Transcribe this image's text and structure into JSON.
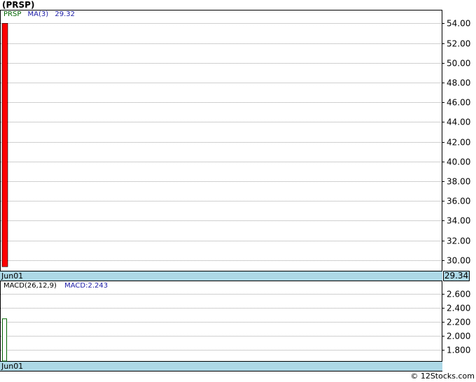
{
  "header": {
    "title": "(PRSP)"
  },
  "price_panel": {
    "symbol_label": "PRSP",
    "ma_label": "MA(3)",
    "ma_value": "29.32",
    "date_label": "Jun01",
    "last_price": "29.34",
    "colors": {
      "bar": "#ff0000",
      "grid": "#a0a0a0",
      "axis_strip": "#add8e6"
    }
  },
  "macd_panel": {
    "label": "MACD(26,12,9)",
    "macd_label": "MACD:2.243",
    "date_label": "Jun01",
    "colors": {
      "bar_outline": "#006400"
    }
  },
  "footer": {
    "credit": "© 12Stocks.com"
  },
  "chart_data": [
    {
      "type": "bar",
      "title": "(PRSP)",
      "categories": [
        "Jun01"
      ],
      "series": [
        {
          "name": "PRSP",
          "high": 54.0,
          "low": 29.34,
          "close": 29.34
        }
      ],
      "ma": {
        "label": "MA(3)",
        "value": 29.32
      },
      "ylim": [
        29.0,
        55.3
      ],
      "yticks": [
        "54.00",
        "52.00",
        "50.00",
        "48.00",
        "46.00",
        "44.00",
        "42.00",
        "40.00",
        "38.00",
        "36.00",
        "34.00",
        "32.00",
        "30.00"
      ],
      "grid": true
    },
    {
      "type": "bar",
      "title": "MACD(26,12,9)",
      "categories": [
        "Jun01"
      ],
      "series": [
        {
          "name": "MACD",
          "values": [
            2.243
          ]
        }
      ],
      "ylim": [
        1.64,
        2.78
      ],
      "yticks": [
        "2.600",
        "2.400",
        "2.200",
        "2.000",
        "1.800"
      ],
      "grid": true
    }
  ]
}
